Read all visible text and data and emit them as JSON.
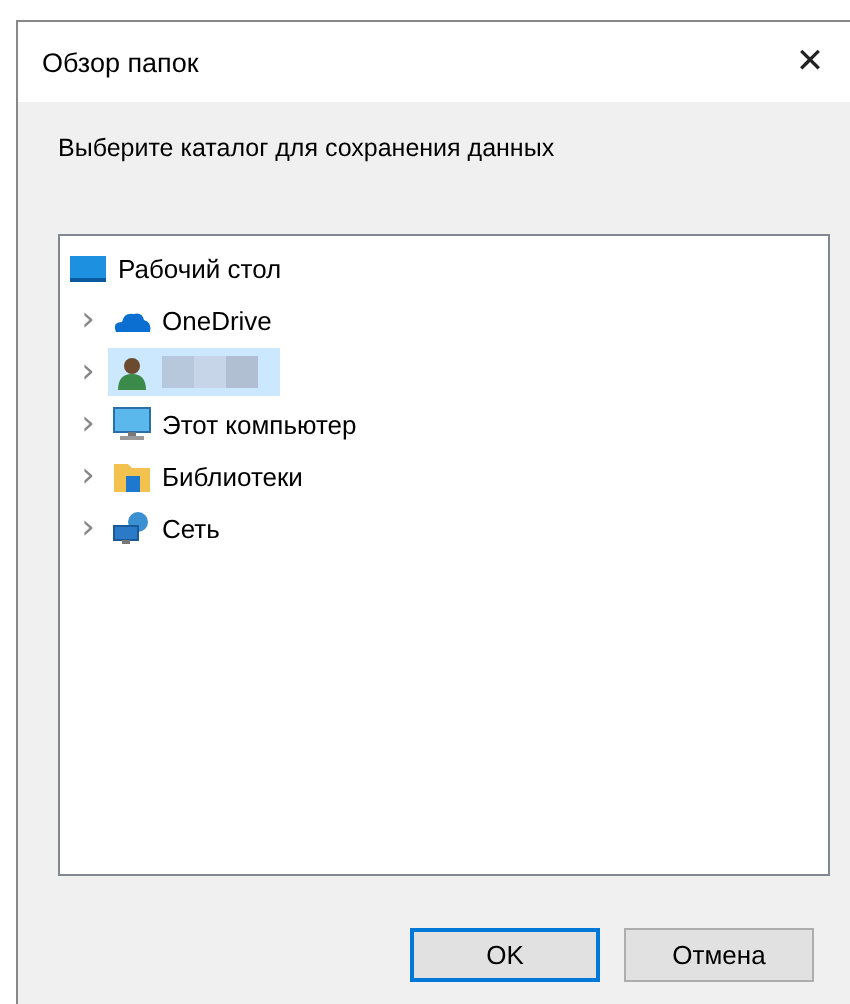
{
  "window": {
    "title": "Обзор папок",
    "close": "✕"
  },
  "prompt": "Выберите каталог для сохранения данных",
  "tree": {
    "label": "Рабочий стол",
    "kind": "desktop",
    "selected": false,
    "children": [
      {
        "label": "OneDrive",
        "kind": "cloud",
        "selected": false,
        "expander": "›"
      },
      {
        "kind": "person",
        "selected": true,
        "redacted": true,
        "expander": "›"
      },
      {
        "label": "Этот компьютер",
        "kind": "monitor",
        "selected": false,
        "expander": "›"
      },
      {
        "label": "Библиотеки",
        "kind": "library",
        "selected": false,
        "expander": "›"
      },
      {
        "label": "Сеть",
        "kind": "network",
        "selected": false,
        "expander": "›"
      }
    ]
  },
  "buttons": [
    {
      "label": "OK",
      "default": true
    },
    {
      "label": "Отмена",
      "default": false
    }
  ]
}
